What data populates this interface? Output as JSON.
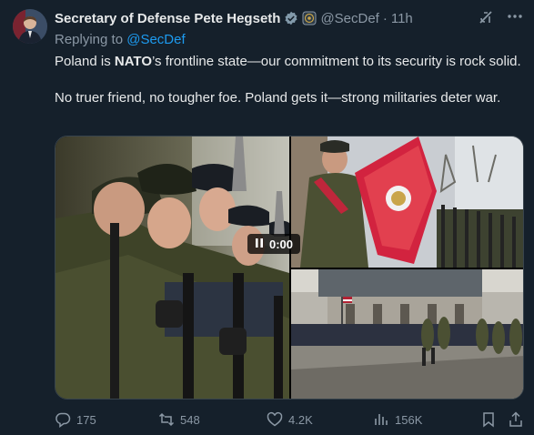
{
  "tweet": {
    "display_name": "Secretary of Defense Pete Hegseth",
    "handle": "@SecDef",
    "separator": "·",
    "time": "11h",
    "replying_prefix": "Replying to",
    "replying_mention": "@SecDef",
    "text_line1_a": "Poland is ",
    "text_line1_bold": "NATO",
    "text_line1_b": "’s frontline state—our commitment to its security is rock solid.",
    "text_line2": "No truer friend, no tougher foe. Poland gets it—strong militaries deter war.",
    "video_time": "0:00"
  },
  "actions": {
    "replies": "175",
    "reposts": "548",
    "likes": "4.2K",
    "views": "156K"
  },
  "icons": {
    "verified": "verified-badge-icon",
    "gov": "government-badge-icon",
    "grok": "grok-icon",
    "more": "more-icon",
    "reply": "reply-icon",
    "repost": "repost-icon",
    "like": "like-icon",
    "views": "views-icon",
    "bookmark": "bookmark-icon",
    "share": "share-icon",
    "play": "play-icon"
  },
  "colors": {
    "background": "#15202b",
    "text": "#e7e9ea",
    "muted": "#8b98a5",
    "link": "#1d9bf0"
  }
}
